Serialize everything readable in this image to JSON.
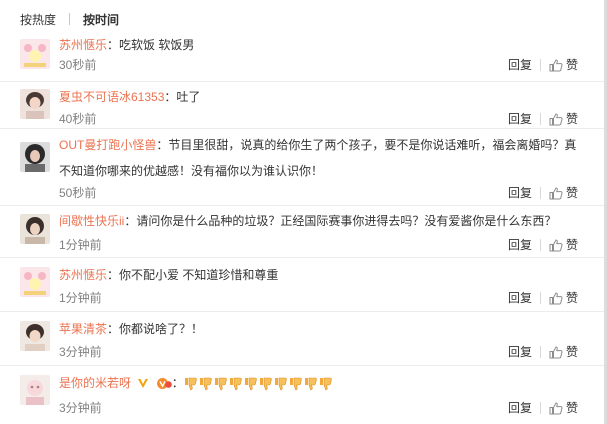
{
  "tabs": [
    {
      "label": "按热度",
      "active": false
    },
    {
      "label": "按时间",
      "active": true
    }
  ],
  "actions": {
    "reply": "回复",
    "like": "赞"
  },
  "comments": [
    {
      "user": "苏州惬乐",
      "sep": "：",
      "text": "吃软饭 软饭男",
      "time": "30秒前"
    },
    {
      "user": "夏虫不可语冰61353",
      "sep": "：",
      "text": "吐了",
      "time": "40秒前"
    },
    {
      "user": "OUT曼打跑小怪兽",
      "sep": "：",
      "text": "节目里很甜，说真的给你生了两个孩子，要不是你说话难听，福会离婚吗？真不知道你哪来的优越感！没有福你以为谁认识你！",
      "time": "50秒前"
    },
    {
      "user": "间歇性快乐ii",
      "sep": "：",
      "text": "请问你是什么品种的垃圾？正经国际赛事你进得去吗？没有爱酱你是什么东西？",
      "time": "1分钟前"
    },
    {
      "user": "苏州惬乐",
      "sep": "：",
      "text": "你不配小爱 不知道珍惜和尊重",
      "time": "1分钟前"
    },
    {
      "user": "苹果清茶",
      "sep": "：",
      "text": "你都说啥了？！",
      "time": "3分钟前"
    },
    {
      "user": "是你的米若呀",
      "sep": "：",
      "text": "",
      "time": "3分钟前",
      "emoji_name": "thumbs-down-emoji",
      "emoji_count": 10
    }
  ],
  "colors": {
    "username": "#eb7350",
    "time": "#808080",
    "text": "#333333",
    "divider": "#ececec"
  }
}
